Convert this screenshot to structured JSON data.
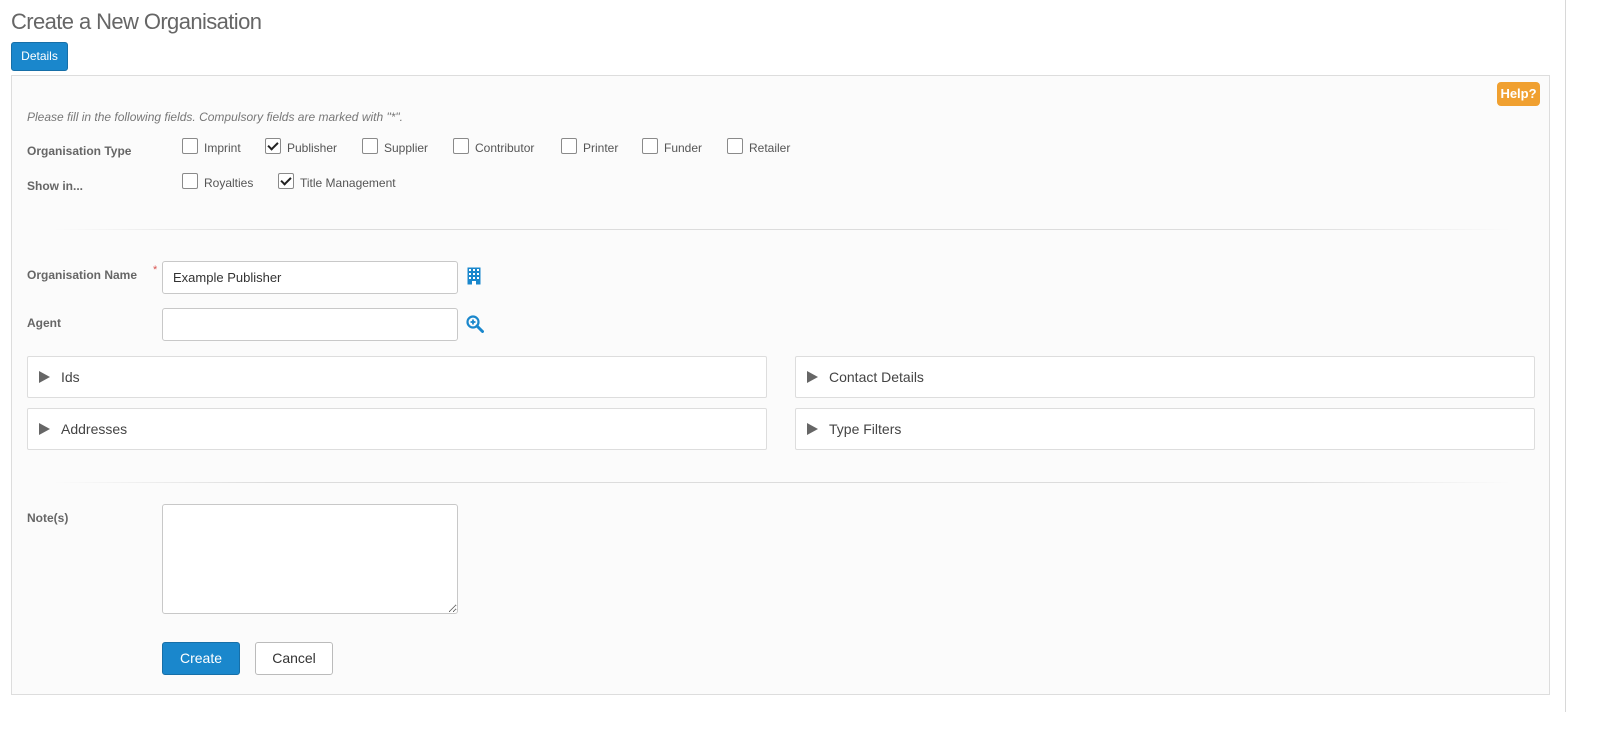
{
  "page": {
    "title": "Create a New Organisation"
  },
  "tabs": {
    "details_label": "Details"
  },
  "help": {
    "label": "Help?"
  },
  "form": {
    "instructions": "Please fill in the following fields. Compulsory fields are marked with \"*\".",
    "org_type": {
      "label": "Organisation Type",
      "options": [
        {
          "label": "Imprint",
          "checked": false
        },
        {
          "label": "Publisher",
          "checked": true
        },
        {
          "label": "Supplier",
          "checked": false
        },
        {
          "label": "Contributor",
          "checked": false
        },
        {
          "label": "Printer",
          "checked": false
        },
        {
          "label": "Funder",
          "checked": false
        },
        {
          "label": "Retailer",
          "checked": false
        }
      ]
    },
    "show_in": {
      "label": "Show in...",
      "options": [
        {
          "label": "Royalties",
          "checked": false
        },
        {
          "label": "Title Management",
          "checked": true
        }
      ]
    },
    "org_name": {
      "label": "Organisation Name",
      "required_marker": "*",
      "value": "Example Publisher",
      "icon": "building-icon"
    },
    "agent": {
      "label": "Agent",
      "value": "",
      "icon": "search-zoom-icon"
    },
    "sections": {
      "ids": "Ids",
      "contact_details": "Contact Details",
      "addresses": "Addresses",
      "type_filters": "Type Filters"
    },
    "notes": {
      "label": "Note(s)",
      "value": ""
    },
    "buttons": {
      "create": "Create",
      "cancel": "Cancel"
    }
  },
  "colors": {
    "primary": "#1a87cc",
    "help": "#f0a030",
    "required": "#d9534f"
  }
}
